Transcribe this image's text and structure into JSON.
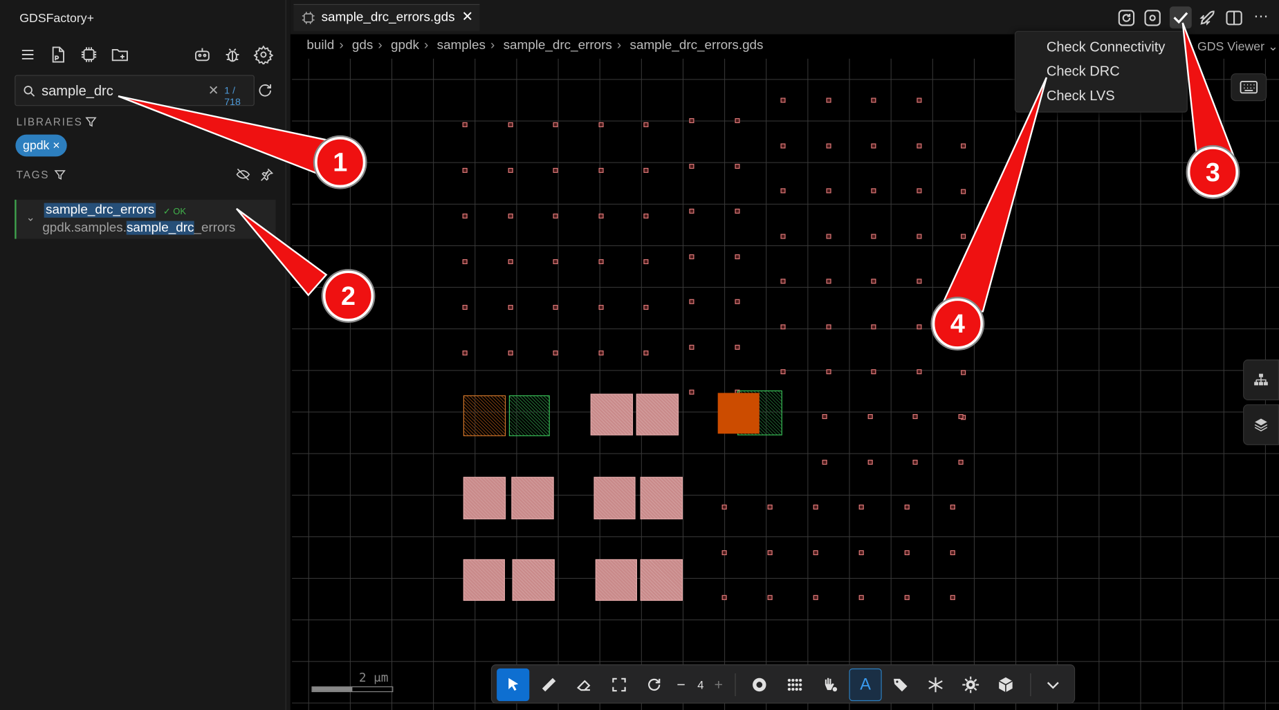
{
  "app_title": "GDSFactory+",
  "search": {
    "value": "sample_drc",
    "count": "1 / 718",
    "clear": "✕"
  },
  "sections": {
    "libraries": "LIBRARIES",
    "tags": "TAGS"
  },
  "library_chip": {
    "label": "gpdk",
    "remove": "×"
  },
  "result": {
    "name": "sample_drc_errors",
    "status": "✓ OK",
    "path_prefix": "gpdk.samples.",
    "path_match": "sample_drc",
    "path_suffix": "_errors"
  },
  "tab": {
    "label": "sample_drc_errors.gds",
    "close": "✕"
  },
  "breadcrumbs": [
    "build",
    "gds",
    "gpdk",
    "samples",
    "sample_drc_errors",
    "sample_drc_errors.gds"
  ],
  "viewer_label": "GDS Viewer",
  "check_menu": {
    "items": [
      "Check Connectivity",
      "Check DRC",
      "Check LVS"
    ]
  },
  "scale_bar": {
    "label": "2 μm"
  },
  "toolbar": {
    "zoom_minus": "−",
    "zoom_value": "4",
    "zoom_plus": "+",
    "text_tool": "A"
  },
  "callouts": [
    "1",
    "2",
    "3",
    "4"
  ],
  "colors": {
    "accent": "#2d7fbf",
    "callout": "#ef1111",
    "ok": "#41b24b",
    "shape_fill": "#c98a8a",
    "orange": "#cc4c00",
    "green": "#3ac45a"
  }
}
